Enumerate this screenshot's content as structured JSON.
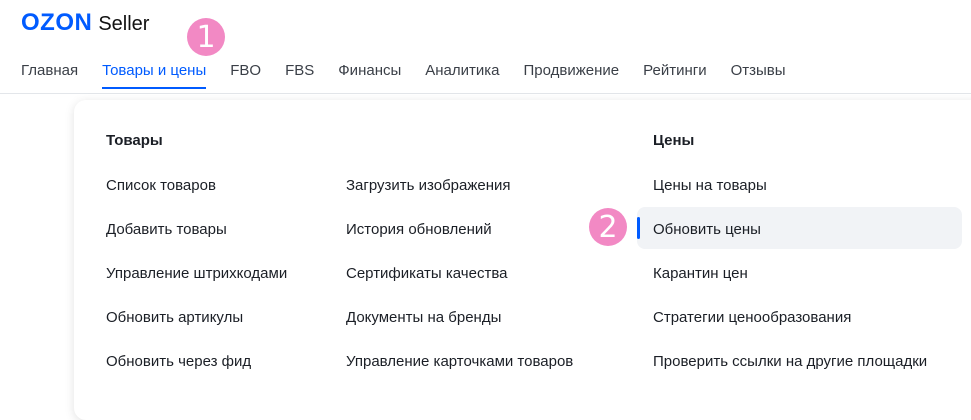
{
  "header": {
    "logo_brand": "OZON",
    "logo_product": "Seller",
    "brand_color": "#005bff"
  },
  "badges": {
    "one": "1",
    "two": "2",
    "color": "#f289c4"
  },
  "nav": {
    "items": [
      {
        "label": "Главная"
      },
      {
        "label": "Товары и цены",
        "active": true
      },
      {
        "label": "FBO"
      },
      {
        "label": "FBS"
      },
      {
        "label": "Финансы"
      },
      {
        "label": "Аналитика"
      },
      {
        "label": "Продвижение"
      },
      {
        "label": "Рейтинги"
      },
      {
        "label": "Отзывы"
      }
    ]
  },
  "dropdown": {
    "products": {
      "heading": "Товары",
      "col1": [
        "Список товаров",
        "Добавить товары",
        "Управление штрихкодами",
        "Обновить артикулы",
        "Обновить через фид"
      ],
      "col2": [
        "Загрузить изображения",
        "История обновлений",
        "Сертификаты качества",
        "Документы на бренды",
        "Управление карточками товаров"
      ]
    },
    "prices": {
      "heading": "Цены",
      "items": [
        "Цены на товары",
        "Обновить цены",
        "Карантин цен",
        "Стратегии ценообразования",
        "Проверить ссылки на другие площадки"
      ],
      "hovered_index": 1
    }
  }
}
